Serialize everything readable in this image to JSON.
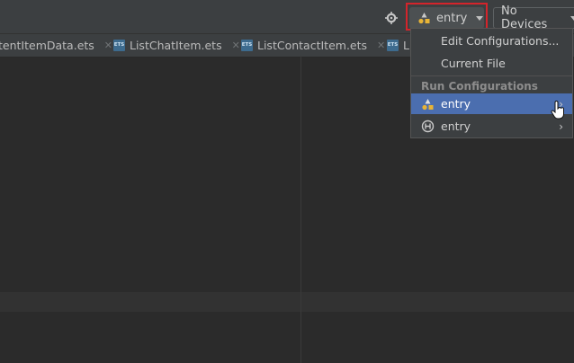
{
  "toolbar": {
    "settings_icon": "target-gear-icon",
    "run_config_label": "entry",
    "device_label": "No Devices"
  },
  "tabs": [
    {
      "label": "tentItemData.ets"
    },
    {
      "label": "ListChatItem.ets"
    },
    {
      "label": "ListContactItem.ets"
    },
    {
      "label": "L"
    }
  ],
  "tab_icon_text": "ETS",
  "dropdown": {
    "edit_configurations": "Edit Configurations...",
    "current_file": "Current File",
    "section_header": "Run Configurations",
    "items": [
      {
        "label": "entry",
        "icon": "app-module-icon",
        "selected": true
      },
      {
        "label": "entry",
        "icon": "harmony-h-icon",
        "selected": false
      }
    ]
  },
  "colors": {
    "background": "#2b2b2b",
    "toolbar": "#3c3f41",
    "selection": "#4b6eaf",
    "highlight_border": "#d4242b"
  }
}
